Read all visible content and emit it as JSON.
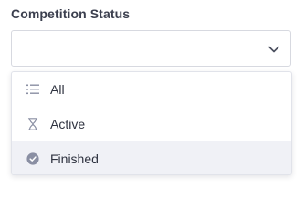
{
  "field": {
    "label": "Competition Status",
    "selected_value": ""
  },
  "dropdown": {
    "options": [
      {
        "label": "All",
        "icon": "list-icon"
      },
      {
        "label": "Active",
        "icon": "hourglass-icon"
      },
      {
        "label": "Finished",
        "icon": "check-circle-icon",
        "highlighted": true
      }
    ]
  },
  "colors": {
    "text": "#2f3340",
    "label": "#3b3f4e",
    "icon": "#8a8fa3",
    "border": "#d7d9e0",
    "hover_bg": "#f0f1f6"
  }
}
